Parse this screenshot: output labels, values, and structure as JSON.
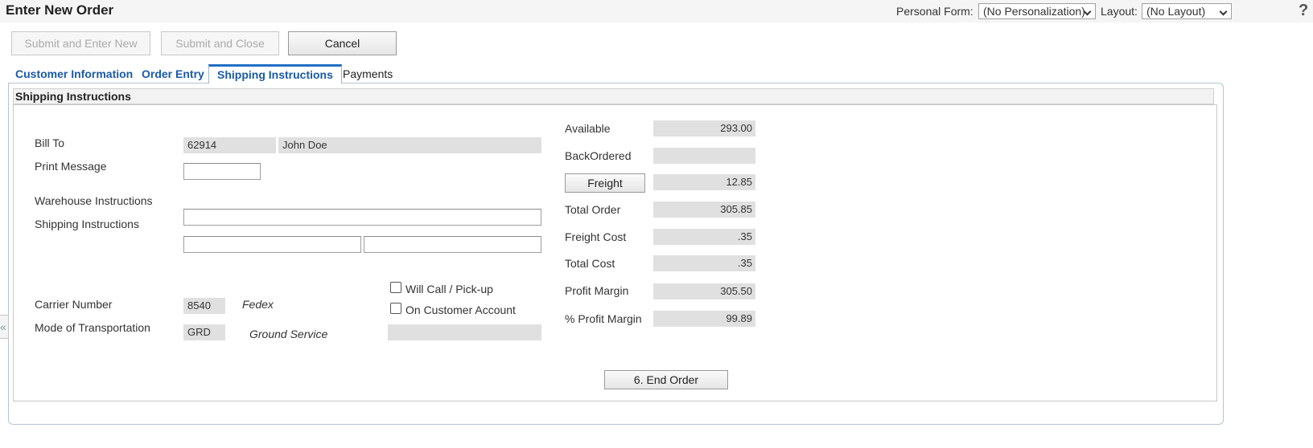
{
  "header": {
    "title": "Enter New Order",
    "personal_form_label": "Personal Form:",
    "personal_form_value": "(No Personalization)",
    "layout_label": "Layout:",
    "layout_value": "(No Layout)",
    "help_glyph": "?"
  },
  "toolbar": {
    "submit_new_label": "Submit and Enter New",
    "submit_close_label": "Submit and Close",
    "cancel_label": "Cancel"
  },
  "tabs": [
    {
      "label": "Customer Information"
    },
    {
      "label": "Order Entry"
    },
    {
      "label": "Shipping Instructions"
    },
    {
      "label": "Payments"
    }
  ],
  "section": {
    "title": "Shipping Instructions"
  },
  "form": {
    "bill_to_label": "Bill To",
    "bill_to_number": "62914",
    "bill_to_name": "John Doe",
    "print_message_label": "Print Message",
    "print_message_value": "",
    "warehouse_instructions_label": "Warehouse Instructions",
    "shipping_instructions_label": "Shipping Instructions",
    "shipping_line1": "",
    "shipping_line2a": "",
    "shipping_line2b": "",
    "carrier_number_label": "Carrier Number",
    "carrier_number_value": "8540",
    "carrier_name": "Fedex",
    "mode_label": "Mode of Transportation",
    "mode_value": "GRD",
    "mode_name": "Ground Service",
    "mode_extra": "",
    "will_call_label": "Will Call / Pick-up",
    "on_account_label": "On Customer Account"
  },
  "totals": {
    "available_label": "Available",
    "available_value": "293.00",
    "backordered_label": "BackOrdered",
    "backordered_value": "",
    "freight_button_label": "Freight",
    "freight_value": "12.85",
    "total_order_label": "Total Order",
    "total_order_value": "305.85",
    "freight_cost_label": "Freight Cost",
    "freight_cost_value": ".35",
    "total_cost_label": "Total Cost",
    "total_cost_value": ".35",
    "profit_margin_label": "Profit Margin",
    "profit_margin_value": "305.50",
    "pct_profit_margin_label": "% Profit Margin",
    "pct_profit_margin_value": "99.89"
  },
  "end_order_label": "6. End Order",
  "collapse_glyph": "«"
}
